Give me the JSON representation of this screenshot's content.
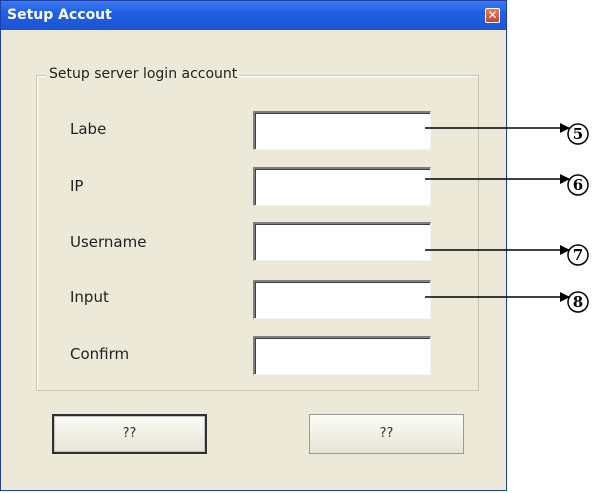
{
  "window": {
    "title": "Setup Accout",
    "close_glyph": "✕"
  },
  "group": {
    "legend": "Setup server login account"
  },
  "fields": [
    {
      "label": "Labe",
      "value": ""
    },
    {
      "label": "IP",
      "value": ""
    },
    {
      "label": "Username",
      "value": ""
    },
    {
      "label": "Input",
      "value": ""
    },
    {
      "label": "Confirm",
      "value": ""
    }
  ],
  "buttons": {
    "ok_label": "??",
    "cancel_label": "??"
  },
  "annotations": [
    "5",
    "6",
    "7",
    "8"
  ]
}
